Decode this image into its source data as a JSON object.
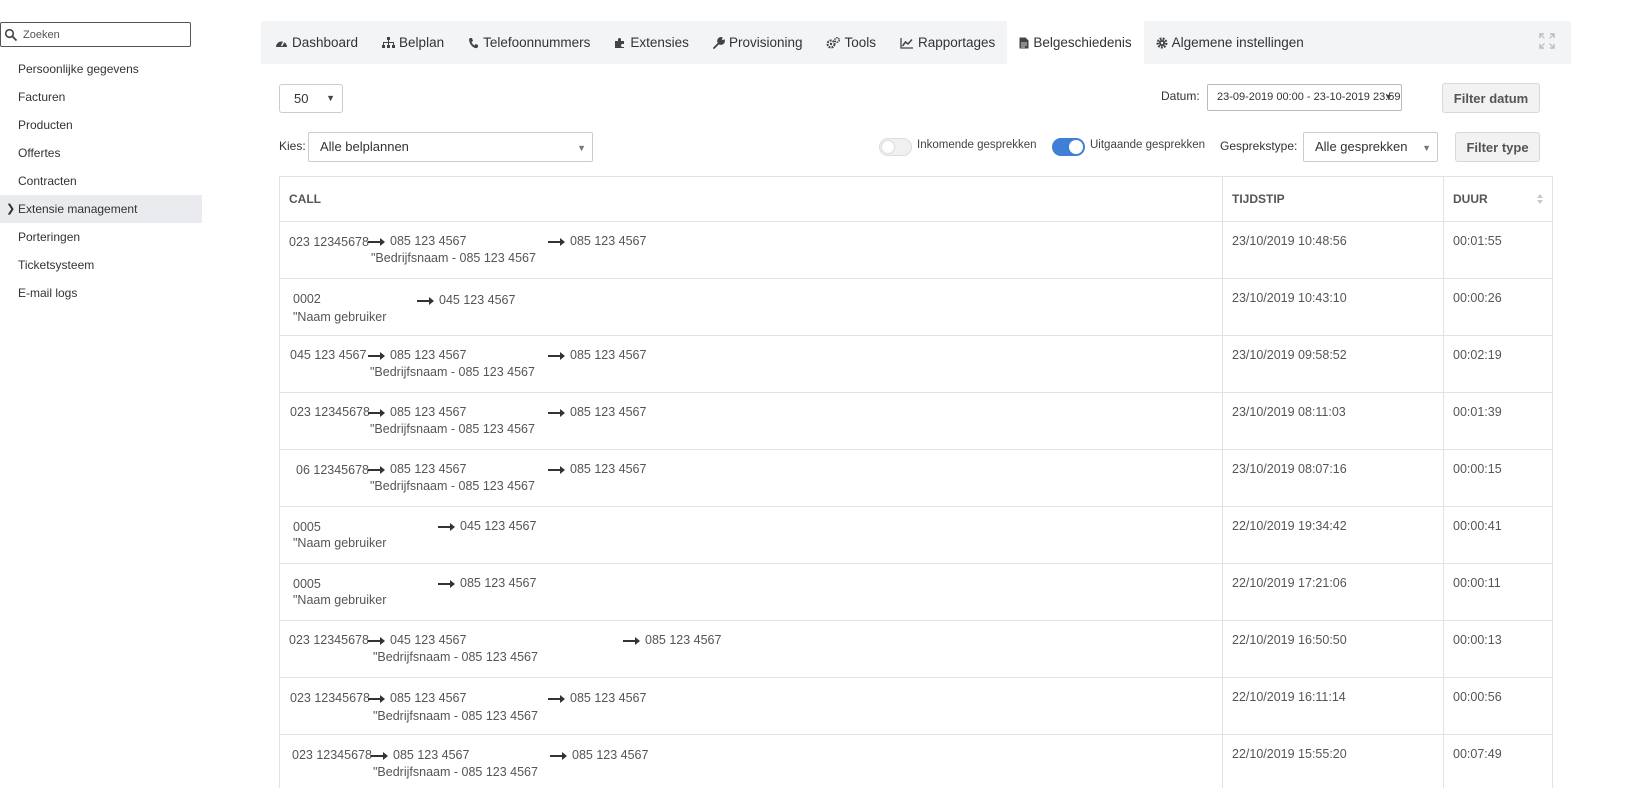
{
  "sidebar": {
    "search_placeholder": "Zoeken",
    "items": [
      {
        "label": "Persoonlijke gegevens"
      },
      {
        "label": "Facturen"
      },
      {
        "label": "Producten"
      },
      {
        "label": "Offertes"
      },
      {
        "label": "Contracten"
      },
      {
        "label": "Extensie management",
        "active": true
      },
      {
        "label": "Porteringen"
      },
      {
        "label": "Ticketsysteem"
      },
      {
        "label": "E-mail logs"
      }
    ]
  },
  "tabs": [
    {
      "label": "Dashboard",
      "icon": "tachometer-icon"
    },
    {
      "label": "Belplan",
      "icon": "sitemap-icon"
    },
    {
      "label": "Telefoonnummers",
      "icon": "phone-icon"
    },
    {
      "label": "Extensies",
      "icon": "puzzle-icon"
    },
    {
      "label": "Provisioning",
      "icon": "wrench-icon"
    },
    {
      "label": "Tools",
      "icon": "cogs-icon"
    },
    {
      "label": "Rapportages",
      "icon": "line-chart-icon"
    },
    {
      "label": "Belgeschiedenis",
      "icon": "file-icon",
      "active": true
    },
    {
      "label": "Algemene instellingen",
      "icon": "gear-icon"
    }
  ],
  "controls": {
    "page_size": "50",
    "datum_label": "Datum:",
    "datum_value": "23-09-2019 00:00 - 23-10-2019 23:59",
    "filter_datum": "Filter datum",
    "kies_label": "Kies:",
    "kies_value": "Alle belplannen",
    "inkomend_label": "Inkomende gesprekken",
    "inkomend_on": false,
    "uitgaand_label": "Uitgaande gesprekken",
    "uitgaand_on": true,
    "gesprekstype_label": "Gesprekstype:",
    "gesprekstype_value": "Alle gesprekken",
    "filter_type": "Filter type",
    "toggle_on_color": "#3f7fd6"
  },
  "table": {
    "headers": {
      "call": "CALL",
      "time": "TIJDSTIP",
      "duration": "DUUR"
    },
    "rows": [
      {
        "from": "023 12345678",
        "to1": "085 123 4567",
        "to2": "085 123 4567",
        "sub": "\"Bedrijfsnaam  - 085 123 4567",
        "time": "23/10/2019 10:48:56",
        "duration": "00:01:55"
      },
      {
        "from": "0002",
        "to2": "045 123 4567",
        "sub": "\"Naam gebruiker",
        "time": "23/10/2019 10:43:10",
        "duration": "00:00:26"
      },
      {
        "from": "045 123 4567",
        "to1": "085 123 4567",
        "to2": "085 123 4567",
        "sub": "\"Bedrijfsnaam  - 085 123 4567",
        "time": "23/10/2019 09:58:52",
        "duration": "00:02:19"
      },
      {
        "from": "023 12345678",
        "to1": "085 123 4567",
        "to2": "085 123 4567",
        "sub": "\"Bedrijfsnaam  - 085 123 4567",
        "time": "23/10/2019 08:11:03",
        "duration": "00:01:39"
      },
      {
        "from": "06 12345678",
        "to1": "085 123 4567",
        "to2": "085 123 4567",
        "sub": "\"Bedrijfsnaam  - 085 123 4567",
        "time": "23/10/2019 08:07:16",
        "duration": "00:00:15"
      },
      {
        "from": "0005",
        "to2": "045 123 4567",
        "sub": "\"Naam gebruiker",
        "time": "22/10/2019 19:34:42",
        "duration": "00:00:41"
      },
      {
        "from": "0005",
        "to2": "085 123 4567",
        "sub": "\"Naam gebruiker",
        "time": "22/10/2019 17:21:06",
        "duration": "00:00:11"
      },
      {
        "from": "023 12345678",
        "to1": "045 123 4567",
        "to2": "085 123 4567",
        "sub": "\"Bedrijfsnaam  - 085 123 4567",
        "time": "22/10/2019 16:50:50",
        "duration": "00:00:13"
      },
      {
        "from": "023 12345678",
        "to1": "085 123 4567",
        "to2": "085 123 4567",
        "sub": "\"Bedrijfsnaam  - 085 123 4567",
        "time": "22/10/2019 16:11:14",
        "duration": "00:00:56"
      },
      {
        "from": "023 12345678",
        "to1": "085 123 4567",
        "to2": "085 123 4567",
        "sub": "\"Bedrijfsnaam  - 085 123 4567",
        "time": "22/10/2019 15:55:20",
        "duration": "00:07:49"
      }
    ]
  }
}
